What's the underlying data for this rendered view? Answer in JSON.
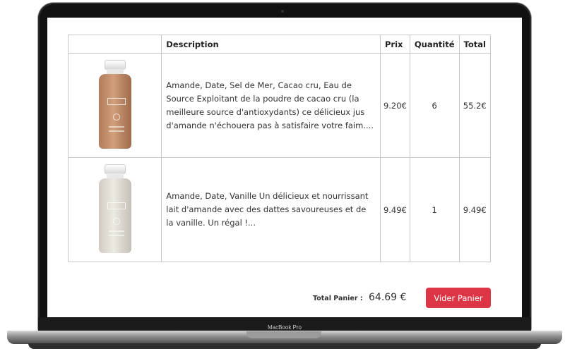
{
  "device": {
    "label": "MacBook Pro"
  },
  "cart": {
    "headers": [
      "",
      "Description",
      "Prix",
      "Quantité",
      "Total"
    ],
    "items": [
      {
        "image": "chocolate-almond-juice-bottle",
        "description": "Amande, Date, Sel de Mer, Cacao cru, Eau de Source Exploitant de la poudre de cacao cru (la meilleure source d'antioxydants) ce délicieux jus d'amande n'échouera pas à satisfaire votre faim....",
        "price": "9.20€",
        "quantity": "6",
        "total": "55.2€"
      },
      {
        "image": "vanilla-almond-juice-bottle",
        "description": "Amande, Date, Vanille Un délicieux et nourrissant lait d'amande avec des dattes savoureuses et de la vanille. Un régal !...",
        "price": "9.49€",
        "quantity": "1",
        "total": "9.49€"
      }
    ],
    "total_label": "Total Panier :",
    "total_value": "64.69 €",
    "clear_button": "Vider Panier"
  },
  "colors": {
    "clear_button_bg": "#dc3545"
  }
}
